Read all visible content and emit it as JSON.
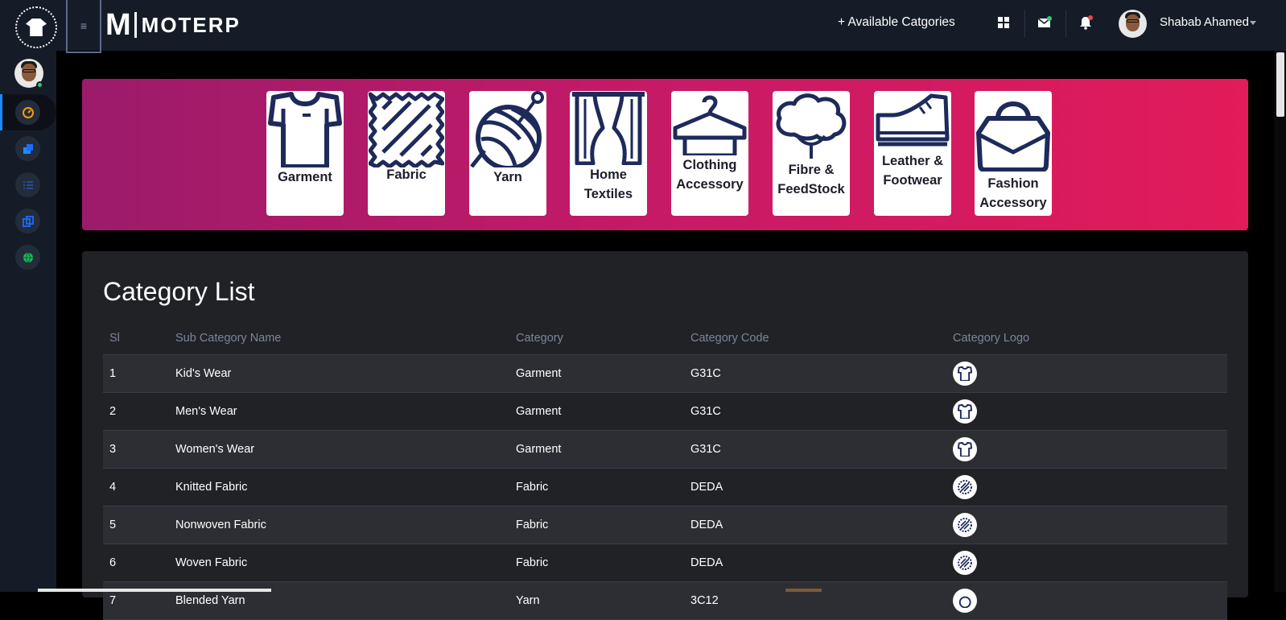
{
  "header": {
    "brand_letter": "M",
    "brand_name": "MOTERP",
    "available_label": "+ Available Catgories",
    "user_name": "Shabab Ahamed"
  },
  "sidebar": {
    "items": [
      {
        "icon": "speedometer-icon",
        "color": "#f39c12",
        "active": true
      },
      {
        "icon": "boxes-icon",
        "color": "#1a8cff"
      },
      {
        "icon": "list-icon",
        "color": "#2a4a9a"
      },
      {
        "icon": "copy-icon",
        "color": "#1a6cff"
      },
      {
        "icon": "globe-icon",
        "color": "#1abc5c"
      }
    ]
  },
  "categories": [
    {
      "label_1": "Garment",
      "label_2": "",
      "icon": "tshirt-icon"
    },
    {
      "label_1": "Fabric",
      "label_2": "",
      "icon": "fabric-icon"
    },
    {
      "label_1": "Yarn",
      "label_2": "",
      "icon": "yarn-icon"
    },
    {
      "label_1": "Home",
      "label_2": "Textiles",
      "icon": "curtain-icon"
    },
    {
      "label_1": "Clothing",
      "label_2": "Accessory",
      "icon": "hanger-icon"
    },
    {
      "label_1": "Fibre &",
      "label_2": "FeedStock",
      "icon": "cotton-icon"
    },
    {
      "label_1": "Leather &",
      "label_2": "Footwear",
      "icon": "shoe-icon"
    },
    {
      "label_1": "Fashion",
      "label_2": "Accessory",
      "icon": "handbag-icon"
    }
  ],
  "table": {
    "title": "Category List",
    "headers": [
      "Sl",
      "Sub Category Name",
      "Category",
      "Category Code",
      "Category Logo"
    ],
    "rows": [
      {
        "sl": "1",
        "name": "Kid's Wear",
        "category": "Garment",
        "code": "G31C",
        "logo": "tshirt-icon"
      },
      {
        "sl": "2",
        "name": "Men's Wear",
        "category": "Garment",
        "code": "G31C",
        "logo": "tshirt-icon"
      },
      {
        "sl": "3",
        "name": "Women's Wear",
        "category": "Garment",
        "code": "G31C",
        "logo": "tshirt-icon"
      },
      {
        "sl": "4",
        "name": "Knitted Fabric",
        "category": "Fabric",
        "code": "DEDA",
        "logo": "fabric-icon"
      },
      {
        "sl": "5",
        "name": "Nonwoven Fabric",
        "category": "Fabric",
        "code": "DEDA",
        "logo": "fabric-icon"
      },
      {
        "sl": "6",
        "name": "Woven Fabric",
        "category": "Fabric",
        "code": "DEDA",
        "logo": "fabric-icon"
      },
      {
        "sl": "7",
        "name": "Blended Yarn",
        "category": "Yarn",
        "code": "3C12",
        "logo": "yarn-icon"
      }
    ]
  },
  "colors": {
    "sidebar_bg": "#151c28",
    "banner_start": "#9b1b6b",
    "banner_end": "#e21b5a",
    "icon_navy": "#1d2a5a",
    "accent_blue": "#1a8cff"
  }
}
